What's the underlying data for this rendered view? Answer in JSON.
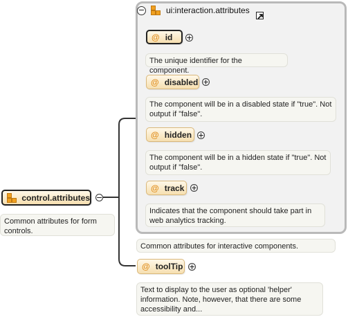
{
  "root": {
    "label": "control.attributes",
    "description": "Common attributes for form controls.",
    "toggle": "−"
  },
  "group": {
    "title": "ui:interaction.attributes",
    "toggle": "−",
    "description": "Common attributes for interactive components."
  },
  "attributes": [
    {
      "label": "id",
      "toggle": "+",
      "description": "The unique identifier for the component."
    },
    {
      "label": "disabled",
      "toggle": "+",
      "description": "The component will be in a disabled state if \"true\". Not output if \"false\"."
    },
    {
      "label": "hidden",
      "toggle": "+",
      "description": "The component will be in a hidden state if \"true\". Not output if \"false\"."
    },
    {
      "label": "track",
      "toggle": "+",
      "description": "Indicates that the component should take part in web analytics tracking."
    }
  ],
  "tooltip": {
    "label": "toolTip",
    "toggle": "+",
    "description": "Text to display to the user as optional 'helper' information. Note, however, that there are some accessibility and..."
  },
  "colors": {
    "accent": "#e19022",
    "node_fill": "#f6dfb0",
    "group_border": "#b9b9b9"
  }
}
